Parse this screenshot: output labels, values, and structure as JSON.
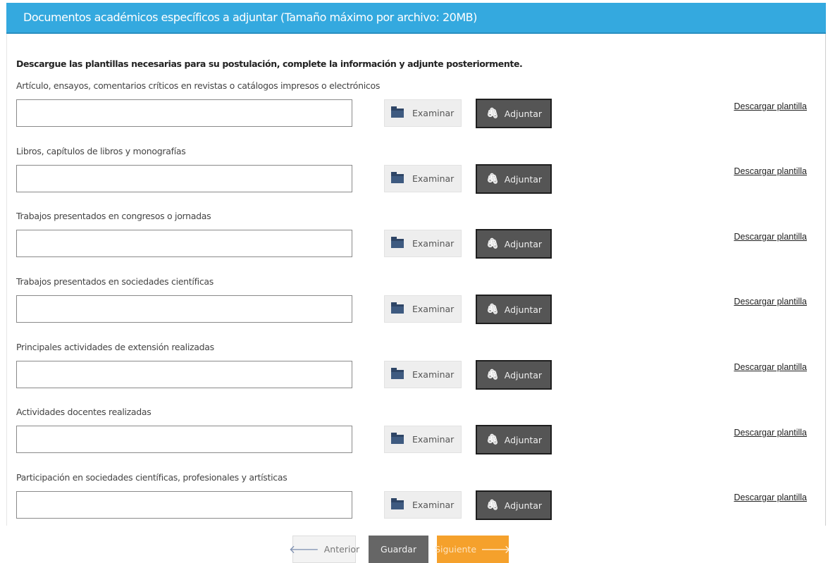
{
  "header": {
    "title": "Documentos académicos específicos a adjuntar (Tamaño máximo por archivo: 20MB)"
  },
  "instructions": "Descargue las plantillas necesarias para su postulación, complete la información y adjunte posteriormente.",
  "rows": [
    {
      "label": "Artículo, ensayos, comentarios críticos en revistas o catálogos impresos o electrónicos",
      "file_value": ""
    },
    {
      "label": "Libros, capítulos de libros y monografías",
      "file_value": ""
    },
    {
      "label": "Trabajos presentados en congresos o jornadas",
      "file_value": ""
    },
    {
      "label": "Trabajos presentados en sociedades científicas",
      "file_value": ""
    },
    {
      "label": "Principales actividades de extensión realizadas",
      "file_value": ""
    },
    {
      "label": "Actividades docentes realizadas",
      "file_value": ""
    },
    {
      "label": "Participación en sociedades científicas, profesionales y artísticas",
      "file_value": ""
    }
  ],
  "buttons": {
    "browse_label": "Examinar",
    "attach_label": "Adjuntar",
    "download_label": "Descargar plantilla"
  },
  "nav": {
    "previous_label": "Anterior",
    "save_label": "Guardar",
    "next_label": "Siguiente"
  },
  "colors": {
    "header_bg": "#34a9df",
    "attach_bg": "#555555",
    "save_bg": "#666666",
    "next_bg": "#f5a12c"
  },
  "icons": {
    "browse": "folder-icon",
    "attach": "paperclip-icon",
    "previous": "arrow-left-icon",
    "next": "arrow-right-icon"
  }
}
